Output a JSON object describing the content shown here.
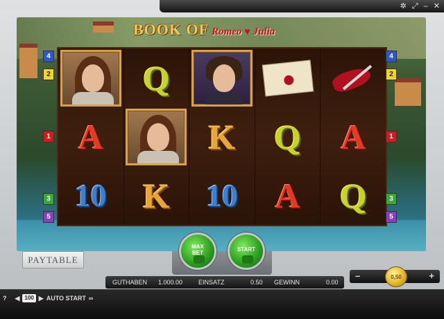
{
  "topbar": {
    "icons": [
      "gear-icon",
      "expand-icon",
      "minimize-icon",
      "close-icon"
    ],
    "glyphs": [
      "✲",
      "⤢",
      "–",
      "✕"
    ]
  },
  "logo": {
    "main": "BOOK OF",
    "sub": "Romeo",
    "sub2": "Julia"
  },
  "reels": [
    [
      "julia",
      "A",
      "10"
    ],
    [
      "Q",
      "julia",
      "K"
    ],
    [
      "romeo",
      "K",
      "10"
    ],
    [
      "letter",
      "Q",
      "A"
    ],
    [
      "dagger",
      "A",
      "Q"
    ]
  ],
  "line_markers": {
    "left": [
      {
        "label": "4",
        "color": "#2b57c9"
      },
      {
        "label": "2",
        "color": "#f2d52a"
      },
      {
        "label": "1",
        "color": "#d81a1a"
      },
      {
        "label": "3",
        "color": "#3aa835"
      },
      {
        "label": "5",
        "color": "#8a3dc2"
      }
    ],
    "right": [
      {
        "label": "4",
        "color": "#2b57c9"
      },
      {
        "label": "2",
        "color": "#f2d52a"
      },
      {
        "label": "1",
        "color": "#d81a1a"
      },
      {
        "label": "3",
        "color": "#3aa835"
      },
      {
        "label": "5",
        "color": "#8a3dc2"
      }
    ]
  },
  "buttons": {
    "paytable": "PAYTABLE",
    "maxbet_l1": "MAX",
    "maxbet_l2": "BET",
    "start": "START"
  },
  "stake": {
    "minus": "–",
    "plus": "+",
    "value": "0,50"
  },
  "info": {
    "guthaben_label": "GUTHABEN",
    "guthaben_value": "1.000.00",
    "einsatz_label": "EINSATZ",
    "einsatz_value": "0.50",
    "gewinn_label": "GEWINN",
    "gewinn_value": "0.00"
  },
  "bottom": {
    "help": "?",
    "count": "100",
    "autostart": "AUTO START",
    "loop": "∞"
  }
}
